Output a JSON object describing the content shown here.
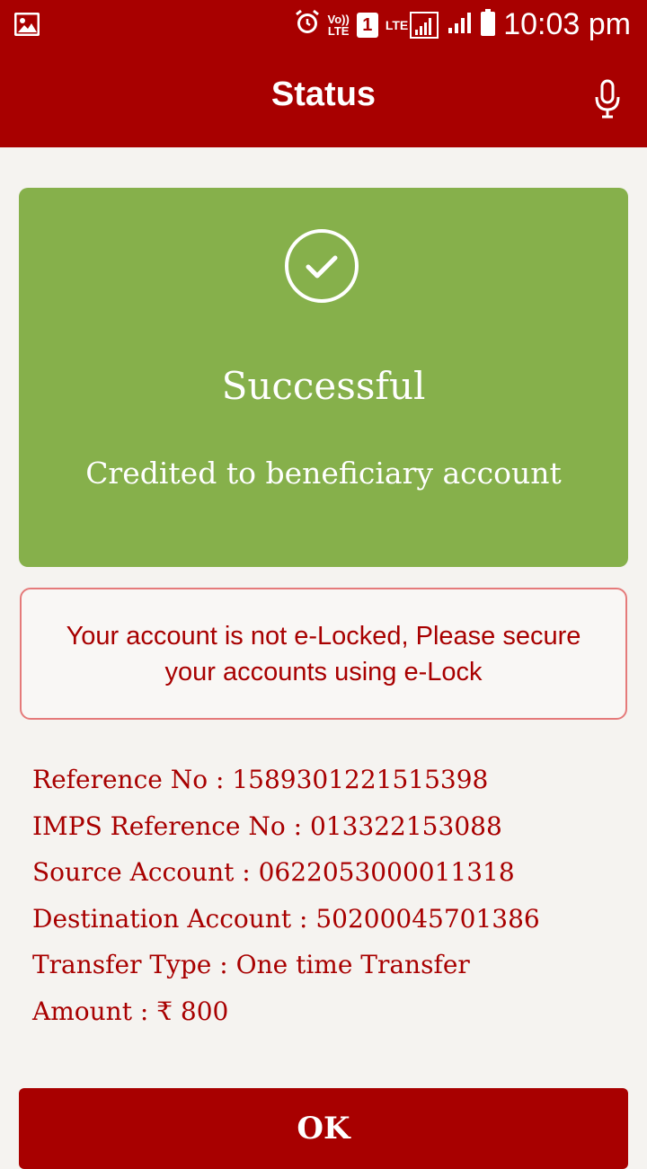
{
  "status_bar": {
    "time": "10:03 pm",
    "volte_label_top": "Vo))",
    "volte_label_bottom": "LTE",
    "sim_badge": "1",
    "lte_label": "LTE"
  },
  "app_bar": {
    "title": "Status"
  },
  "success_card": {
    "title": "Successful",
    "subtitle": "Credited to beneficiary account",
    "color": "#86b04b"
  },
  "alert": {
    "line1": "Your account is not e-Locked, Please secure",
    "line2": "your accounts using e-Lock"
  },
  "details": [
    {
      "label": "Reference No",
      "value": "1589301221515398"
    },
    {
      "label": "IMPS Reference No",
      "value": "013322153088"
    },
    {
      "label": "Source Account",
      "value": "0622053000011318"
    },
    {
      "label": "Destination Account",
      "value": "50200045701386"
    },
    {
      "label": "Transfer Type",
      "value": "One time Transfer"
    },
    {
      "label": "Amount",
      "value": "₹ 800"
    }
  ],
  "ok_button": {
    "label": "OK"
  },
  "colors": {
    "brand": "#a80000",
    "success": "#86b04b",
    "background": "#f5f3f0"
  },
  "icons": [
    "image-icon",
    "alarm-icon",
    "volte-icon",
    "sim-1-icon",
    "lte-signal-icon",
    "signal-icon",
    "battery-icon",
    "microphone-icon",
    "check-circle-icon"
  ]
}
